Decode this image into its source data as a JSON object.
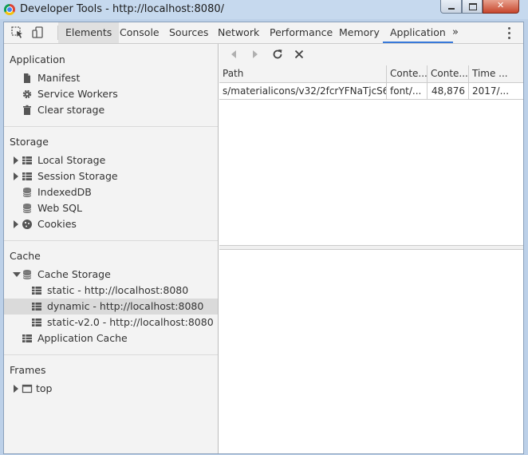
{
  "window": {
    "title": "Developer Tools - http://localhost:8080/"
  },
  "toolbar": {
    "tabs": [
      {
        "label": "Elements"
      },
      {
        "label": "Console"
      },
      {
        "label": "Sources"
      },
      {
        "label": "Network"
      },
      {
        "label": "Performance"
      },
      {
        "label": "Memory"
      },
      {
        "label": "Application"
      }
    ],
    "more_label": "»",
    "active_tab": "Application",
    "icons": [
      "inspect-element-icon",
      "device-toolbar-icon",
      "more-tabs-icon",
      "kebab-menu-icon"
    ]
  },
  "sidebar": {
    "application": {
      "title": "Application",
      "items": [
        {
          "label": "Manifest",
          "icon": "file-icon"
        },
        {
          "label": "Service Workers",
          "icon": "gear-icon"
        },
        {
          "label": "Clear storage",
          "icon": "trash-icon"
        }
      ]
    },
    "storage": {
      "title": "Storage",
      "items": [
        {
          "label": "Local Storage",
          "icon": "grid-icon",
          "expandable": true
        },
        {
          "label": "Session Storage",
          "icon": "grid-icon",
          "expandable": true
        },
        {
          "label": "IndexedDB",
          "icon": "database-icon"
        },
        {
          "label": "Web SQL",
          "icon": "database-icon"
        },
        {
          "label": "Cookies",
          "icon": "cookie-icon",
          "expandable": true
        }
      ]
    },
    "cache": {
      "title": "Cache",
      "cache_storage": {
        "label": "Cache Storage",
        "icon": "database-icon",
        "expanded": true
      },
      "entries": [
        {
          "label": "static - http://localhost:8080",
          "selected": false
        },
        {
          "label": "dynamic - http://localhost:8080",
          "selected": true
        },
        {
          "label": "static-v2.0 - http://localhost:8080",
          "selected": false
        }
      ],
      "application_cache": {
        "label": "Application Cache",
        "icon": "grid-icon"
      }
    },
    "frames": {
      "title": "Frames",
      "items": [
        {
          "label": "top",
          "icon": "frame-icon",
          "expandable": true
        }
      ]
    }
  },
  "cache_view": {
    "toolbar_icons": [
      "previous-page-icon",
      "next-page-icon",
      "refresh-icon",
      "delete-icon"
    ],
    "columns": [
      "Path",
      "Conte...",
      "Conte...",
      "Time ..."
    ],
    "rows": [
      [
        "s/materialicons/v32/2fcrYFNaTjcS6g...",
        "font/...",
        "48,876",
        "2017/..."
      ]
    ]
  },
  "colors": {
    "selected_tab_underline": "#3879d9",
    "selected_item_background": "#dadada",
    "sidebar_background": "#f3f3f3"
  }
}
